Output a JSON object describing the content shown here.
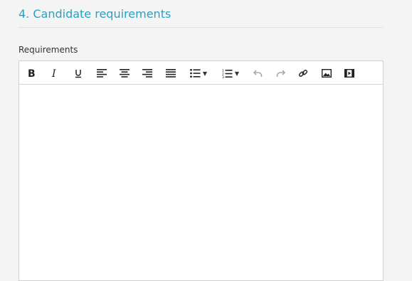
{
  "section": {
    "title": "4. Candidate requirements"
  },
  "field": {
    "label": "Requirements",
    "value": ""
  },
  "toolbar": {
    "buttons": [
      {
        "name": "bold-icon",
        "enabled": true
      },
      {
        "name": "italic-icon",
        "enabled": true
      },
      {
        "name": "underline-icon",
        "enabled": true
      },
      {
        "name": "align-left-icon",
        "enabled": true
      },
      {
        "name": "align-center-icon",
        "enabled": true
      },
      {
        "name": "align-right-icon",
        "enabled": true
      },
      {
        "name": "align-justify-icon",
        "enabled": true
      },
      {
        "name": "bullet-list-icon",
        "enabled": true
      },
      {
        "name": "numbered-list-icon",
        "enabled": true
      },
      {
        "name": "undo-icon",
        "enabled": false
      },
      {
        "name": "redo-icon",
        "enabled": false
      },
      {
        "name": "link-icon",
        "enabled": true
      },
      {
        "name": "image-icon",
        "enabled": true
      },
      {
        "name": "media-icon",
        "enabled": true
      }
    ]
  },
  "colors": {
    "title": "#2a9fc4",
    "background": "#f4f4f4",
    "disabled_icon": "#aaaaaa"
  }
}
